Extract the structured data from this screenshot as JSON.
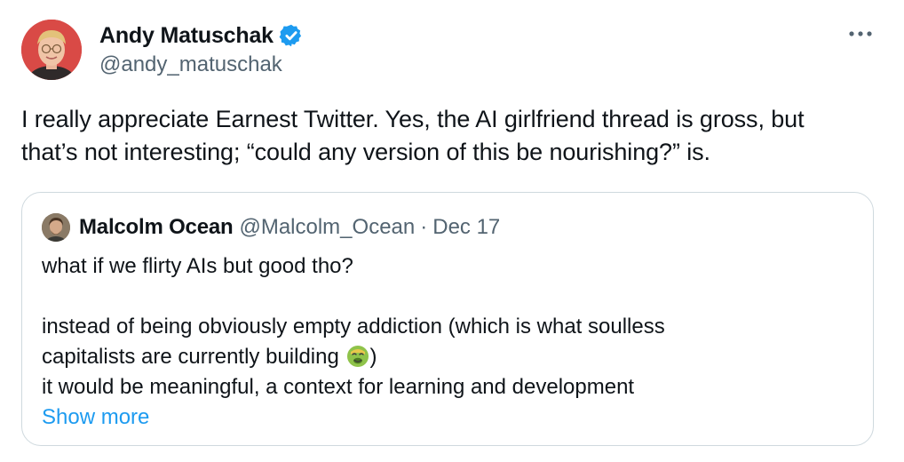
{
  "author": {
    "display_name": "Andy Matuschak",
    "handle": "@andy_matuschak",
    "verified_icon": "verified-badge-icon",
    "avatar_icon": "avatar-andy"
  },
  "menu": {
    "more_icon": "more-options-icon"
  },
  "tweet": {
    "text_line_1": "I really appreciate Earnest Twitter. Yes, the AI girlfriend thread is gross, but",
    "text_line_2": "that’s not interesting; “could any version of this be nourishing?” is."
  },
  "quote": {
    "display_name": "Malcolm Ocean",
    "handle": "@Malcolm_Ocean",
    "separator": "·",
    "date": "Dec 17",
    "lines": [
      "what if we flirty AIs but good tho?",
      "",
      "instead of being obviously empty addiction (which is what soulless",
      "capitalists are currently building",
      ")",
      "it would be meaningful, a context for learning and development"
    ],
    "emoji_icon": "nauseated-face-emoji",
    "show_more": "Show more"
  },
  "colors": {
    "link": "#1d9bf0",
    "muted": "#536471",
    "border": "#cfd9de",
    "verified": "#1d9bf0"
  }
}
